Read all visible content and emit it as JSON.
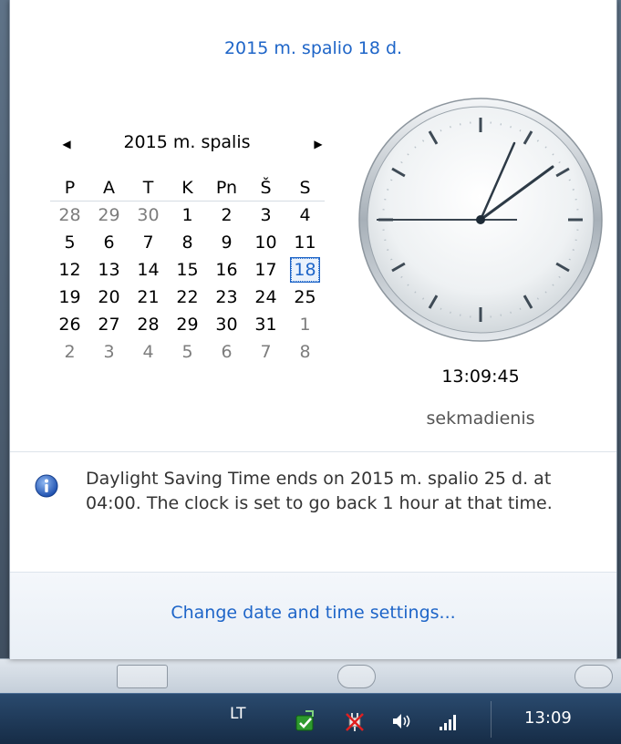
{
  "popup": {
    "long_date": "2015 m. spalio 18 d.",
    "calendar": {
      "title": "2015 m. spalis",
      "prev_label": "◀",
      "next_label": "▶",
      "weekdays": [
        "P",
        "A",
        "T",
        "K",
        "Pn",
        "Š",
        "S"
      ],
      "weeks": [
        [
          "28",
          "29",
          "30",
          "1",
          "2",
          "3",
          "4"
        ],
        [
          "5",
          "6",
          "7",
          "8",
          "9",
          "10",
          "11"
        ],
        [
          "12",
          "13",
          "14",
          "15",
          "16",
          "17",
          "18"
        ],
        [
          "19",
          "20",
          "21",
          "22",
          "23",
          "24",
          "25"
        ],
        [
          "26",
          "27",
          "28",
          "29",
          "30",
          "31",
          "1"
        ],
        [
          "2",
          "3",
          "4",
          "5",
          "6",
          "7",
          "8"
        ]
      ],
      "selected_day": "18"
    },
    "clock": {
      "time": "13:09:45",
      "day_name": "sekmadienis"
    },
    "info": {
      "icon": "info-icon",
      "text": "Daylight Saving Time ends on 2015 m. spalio 25 d. at 04:00. The clock is set to go back 1 hour at that time."
    },
    "settings_link": "Change date and time settings..."
  },
  "taskbar": {
    "language": "LT",
    "tray_icons": [
      "sync-check-icon",
      "power-plug-icon",
      "speaker-icon",
      "signal-bars-icon"
    ],
    "time": "13:09"
  },
  "colors": {
    "link": "#1e65c8",
    "taskbar": "#1f3a5a"
  }
}
